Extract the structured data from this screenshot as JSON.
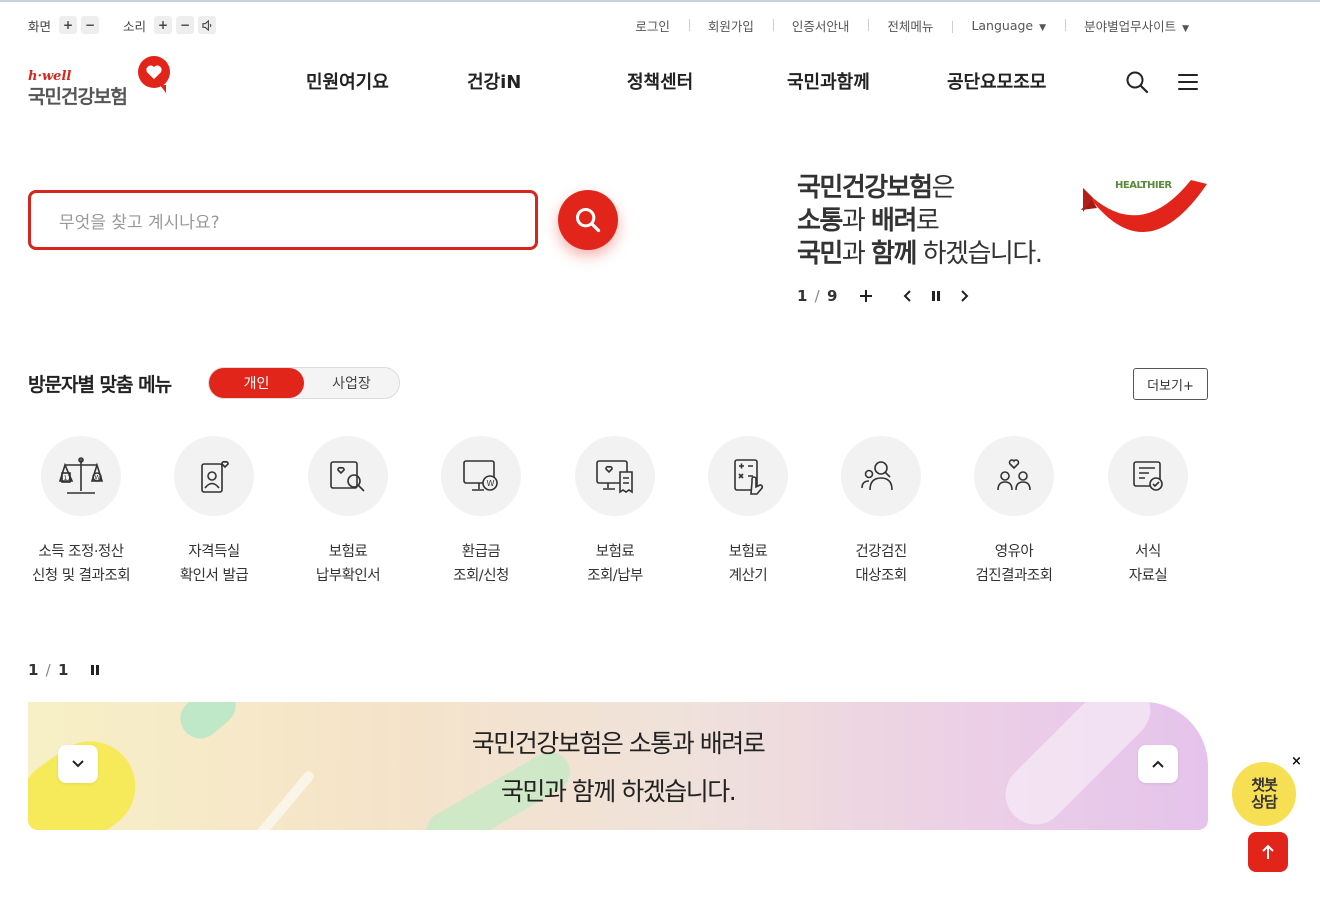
{
  "utility": {
    "screen_label": "화면",
    "sound_label": "소리",
    "zoom_in": "+",
    "zoom_out": "−",
    "vol_up": "+",
    "vol_down": "−",
    "links": {
      "login": "로그인",
      "signup": "회원가입",
      "certificate": "인증서안내",
      "all_menu": "전체메뉴",
      "language": "Language",
      "business_site": "분야별업무사이트"
    }
  },
  "logo": {
    "tagline": "h·well",
    "name": "국민건강보험"
  },
  "gnb": [
    "민원여기요",
    "건강iN",
    "정책센터",
    "국민과함께",
    "공단요모조모"
  ],
  "search": {
    "placeholder": "무엇을 찾고 계시나요?"
  },
  "slogan": {
    "line1_bold": "국민건강보험",
    "line1_rest": "은",
    "line2_bold1": "소통",
    "line2_mid": "과 ",
    "line2_bold2": "배려",
    "line2_rest": "로",
    "line3_bold1": "국민",
    "line3_mid": "과 ",
    "line3_bold2": "함께",
    "line3_rest": " 하겠습니다.",
    "badge": "HEALTHIER",
    "page_current": "1",
    "page_sep": "/",
    "page_total": "9"
  },
  "visitor_menu": {
    "title": "방문자별 맞춤 메뉴",
    "tab_personal": "개인",
    "tab_business": "사업장",
    "more": "더보기+",
    "items": [
      {
        "l1": "소득 조정·정산",
        "l2": "신청 및 결과조회",
        "icon": "scale-icon"
      },
      {
        "l1": "자격득실",
        "l2": "확인서 발급",
        "icon": "id-card-heart-icon"
      },
      {
        "l1": "보험료",
        "l2": "납부확인서",
        "icon": "document-search-icon"
      },
      {
        "l1": "환급금",
        "l2": "조회/신청",
        "icon": "monitor-won-icon"
      },
      {
        "l1": "보험료",
        "l2": "조회/납부",
        "icon": "monitor-receipt-icon"
      },
      {
        "l1": "보험료",
        "l2": "계산기",
        "icon": "calculator-icon"
      },
      {
        "l1": "건강검진",
        "l2": "대상조회",
        "icon": "people-search-icon"
      },
      {
        "l1": "영유아",
        "l2": "검진결과조회",
        "icon": "family-heart-icon"
      },
      {
        "l1": "서식",
        "l2": "자료실",
        "icon": "form-check-icon"
      }
    ]
  },
  "banner": {
    "page_current": "1",
    "page_sep": "/",
    "page_total": "1",
    "line1": "국민건강보험은 소통과 배려로",
    "line2": "국민과 함께 하겠습니다."
  },
  "floating": {
    "chatbot_line1": "챗봇",
    "chatbot_line2": "상담",
    "close": "×"
  },
  "colors": {
    "brand_red": "#e1251b",
    "chatbot_yellow": "#f7df53"
  }
}
